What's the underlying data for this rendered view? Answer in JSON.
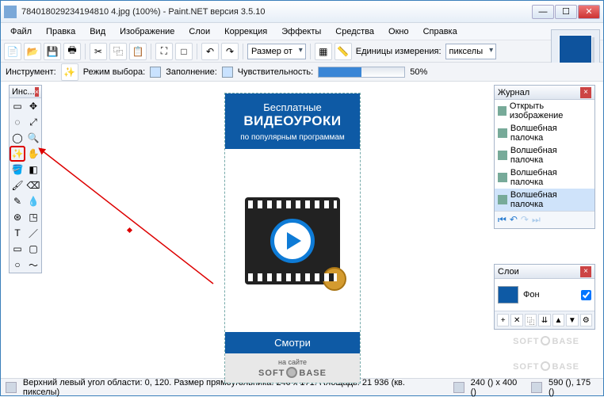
{
  "titlebar": {
    "text": "784018029234194810 4.jpg (100%) - Paint.NET версия 3.5.10"
  },
  "menu": [
    "Файл",
    "Правка",
    "Вид",
    "Изображение",
    "Слои",
    "Коррекция",
    "Эффекты",
    "Средства",
    "Окно",
    "Справка"
  ],
  "toolbar": {
    "size_label": "Размер от",
    "units_label": "Единицы измерения:",
    "units_value": "пикселы"
  },
  "subtoolbar": {
    "tool_label": "Инструмент:",
    "mode_label": "Режим выбора:",
    "fill_label": "Заполнение:",
    "sens_label": "Чувствительность:",
    "sens_value": "50%",
    "sens_pct": 50
  },
  "toolbox": {
    "title": "Инс..."
  },
  "banner": {
    "line1": "Бесплатные",
    "line2": "ВИДЕОУРОКИ",
    "line3": "по популярным программам",
    "cta": "Смотри",
    "on_site": "на сайте",
    "logo_left": "SOFT",
    "logo_right": "BASE"
  },
  "journal": {
    "title": "Журнал",
    "items": [
      "Открыть изображение",
      "Волшебная палочка",
      "Волшебная палочка",
      "Волшебная палочка",
      "Волшебная палочка"
    ]
  },
  "layers": {
    "title": "Слои",
    "item": "Фон"
  },
  "status": {
    "left_text": "Верхний левый угол области: 0, 120. Размер прямоугольника: 240 x 171. Площадь: 21 936 (кв. пикселы)",
    "dims": "240 () x 400 ()",
    "coords": "590 (), 175 ()"
  },
  "watermark": {
    "left": "SOFT",
    "right": "BASE"
  }
}
